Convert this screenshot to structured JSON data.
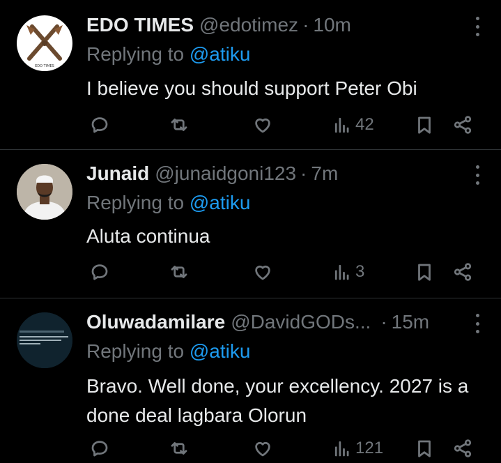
{
  "tweets": [
    {
      "name": "EDO TIMES",
      "handle": "@edotimez",
      "separator": "·",
      "time": "10m",
      "replying_prefix": "Replying to ",
      "replying_to": "@atiku",
      "body": "I believe you should support Peter Obi",
      "views": "42",
      "avatar_icon": "crossed-swords-logo-avatar",
      "avatar_label": "EDO TIMES"
    },
    {
      "name": "Junaid",
      "handle": "@junaidgoni123",
      "separator": "·",
      "time": "7m",
      "replying_prefix": "Replying to ",
      "replying_to": "@atiku",
      "body": "Aluta continua",
      "views": "3",
      "avatar_icon": "person-photo-avatar"
    },
    {
      "name": "Oluwadamilare",
      "handle": "@DavidGODs...",
      "separator": "·",
      "time": "15m",
      "replying_prefix": "Replying to ",
      "replying_to": "@atiku",
      "body": "Bravo. Well done, your excellency. 2027 is a done deal lagbara Olorun",
      "views": "121",
      "avatar_icon": "dark-screen-avatar"
    }
  ],
  "icons": {
    "reply": "reply-icon",
    "retweet": "retweet-icon",
    "like": "like-icon",
    "views": "views-icon",
    "bookmark": "bookmark-icon",
    "share": "share-icon",
    "more": "more-icon"
  },
  "colors": {
    "background": "#000000",
    "text": "#e7e9ea",
    "muted": "#71767b",
    "mention": "#1d9bf0",
    "divider": "#2f3336"
  }
}
